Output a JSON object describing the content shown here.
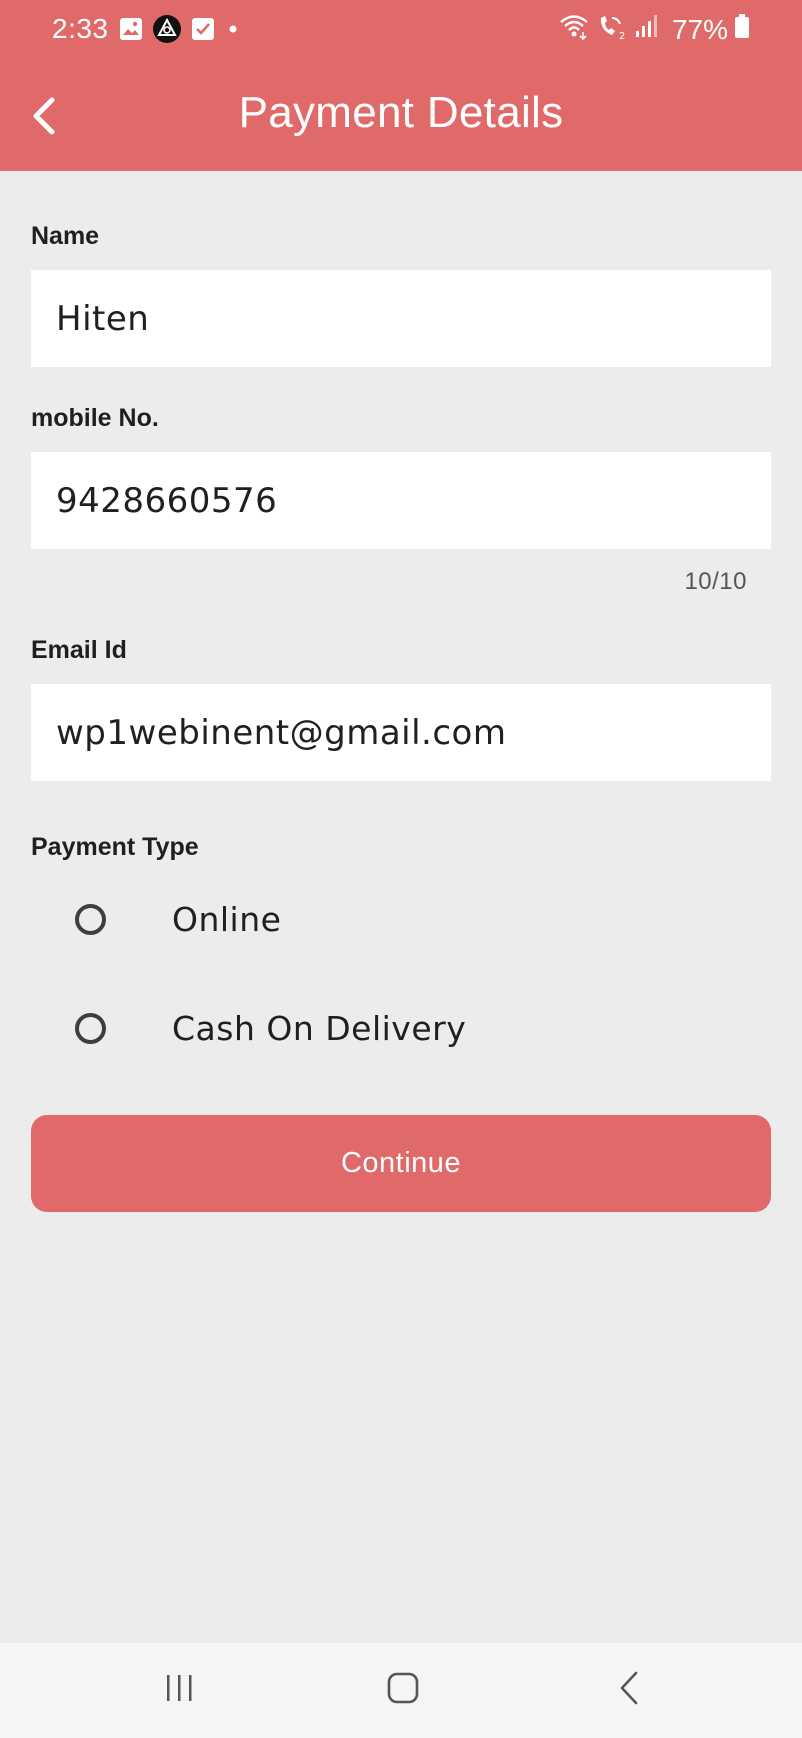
{
  "status_bar": {
    "time": "2:33",
    "battery": "77%",
    "left_icons": [
      "gallery-icon",
      "app-icon",
      "checkbox-icon",
      "dot-icon"
    ],
    "right_icons": [
      "wifi-icon",
      "wifi-calling-icon",
      "signal-icon",
      "battery-icon"
    ]
  },
  "toolbar": {
    "title": "Payment Details",
    "back_icon": "back-arrow-icon"
  },
  "form": {
    "name": {
      "label": "Name",
      "value": "Hiten"
    },
    "mobile": {
      "label": "mobile No.",
      "value": "9428660576",
      "counter": "10/10"
    },
    "email": {
      "label": "Email Id",
      "value": "wp1webinent@gmail.com"
    },
    "payment_type": {
      "label": "Payment Type",
      "options": [
        {
          "label": "Online",
          "selected": false
        },
        {
          "label": "Cash On Delivery",
          "selected": false
        }
      ]
    },
    "continue_label": "Continue"
  },
  "nav_bar": {
    "buttons": [
      "recents-icon",
      "home-icon",
      "back-icon"
    ]
  },
  "colors": {
    "accent": "#e06a6a",
    "background": "#ececec",
    "field_background": "#ffffff"
  }
}
